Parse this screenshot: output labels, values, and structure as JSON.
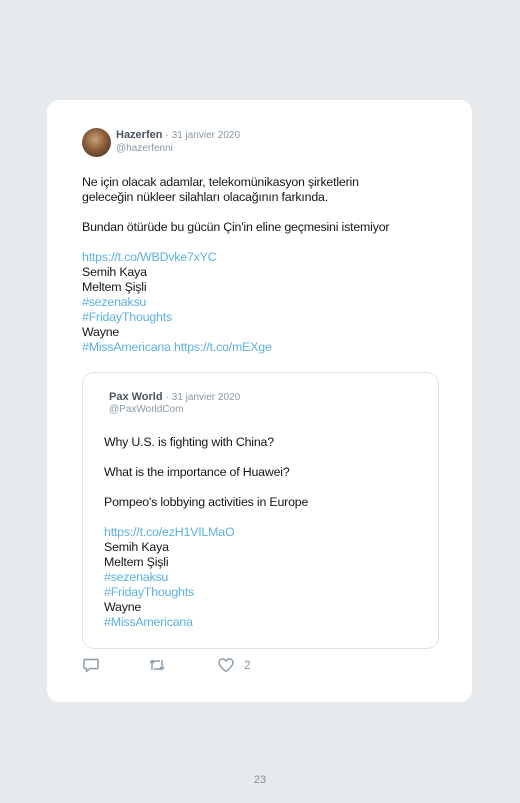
{
  "tweet": {
    "author": {
      "name": "Hazerfen",
      "date": "· 31 janvier 2020",
      "handle": "@hazerfenni"
    },
    "lines": [
      "Ne için olacak adamlar, telekomünikasyon şirketlerin",
      "geleceğin nükleer silahları olacağının farkında.",
      "Bundan ötürüde bu gücün Çin'in eline geçmesini istemiyor",
      "https://t.co/WBDvke7xYC",
      "Semih Kaya",
      "Meltem Şişli",
      "#sezenaksu",
      "#FridayThoughts",
      "Wayne",
      "#MissAmericana https://t.co/mEXge"
    ],
    "quoted": {
      "name": "Pax World",
      "date": "· 31 janvier 2020",
      "handle": "@PaxWorldCom",
      "lines": [
        "Why U.S. is fighting with China?",
        "What is the importance of Huawei?",
        "Pompeo's lobbying activities in Europe",
        "https://t.co/ezH1VILMaO",
        "Semih Kaya",
        "Meltem Şişli",
        "#sezenaksu",
        "#FridayThoughts",
        "Wayne",
        "#MissAmericana"
      ]
    },
    "actions": {
      "reply_icon": "reply-icon",
      "retweet_icon": "retweet-icon",
      "like_icon": "heart-icon",
      "like_count": "2"
    }
  },
  "page_number": "23",
  "colors": {
    "background": "#e6eaed",
    "card": "#ffffff",
    "link": "#5ab1e6",
    "muted": "#8899a6"
  }
}
